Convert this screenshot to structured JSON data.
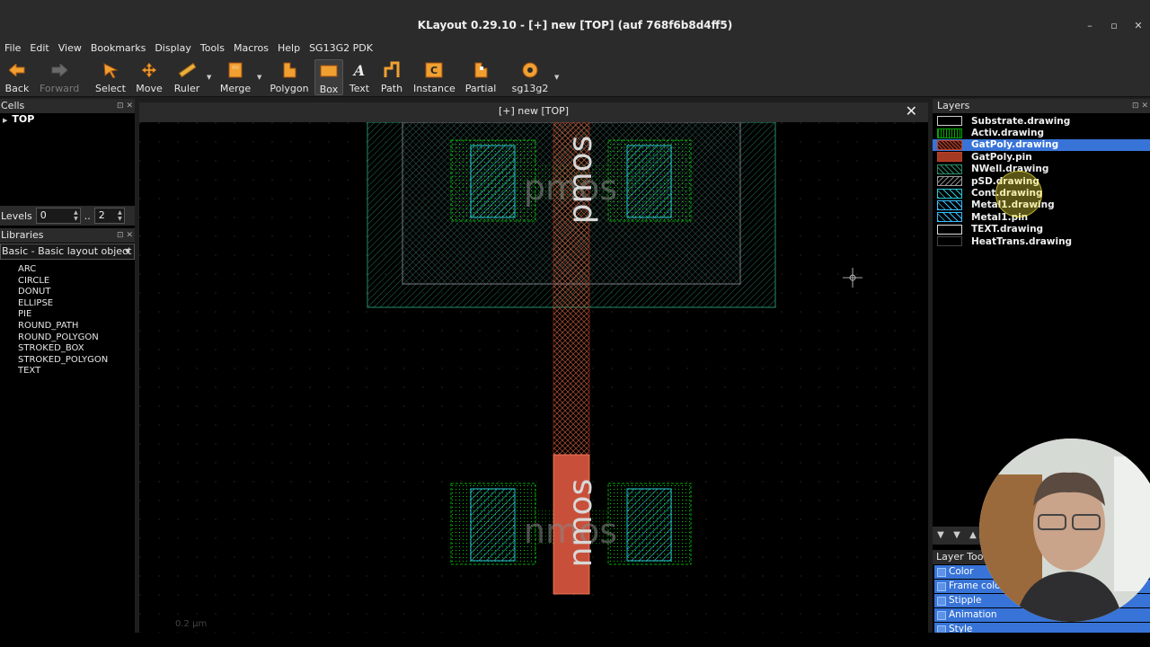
{
  "window": {
    "title": "KLayout 0.29.10 - [+] new [TOP] (auf 768f6b8d4ff5)"
  },
  "menu": [
    "File",
    "Edit",
    "View",
    "Bookmarks",
    "Display",
    "Tools",
    "Macros",
    "Help",
    "SG13G2 PDK"
  ],
  "toolbar": {
    "back": "Back",
    "forward": "Forward",
    "select": "Select",
    "move": "Move",
    "ruler": "Ruler",
    "merge": "Merge",
    "polygon": "Polygon",
    "box": "Box",
    "text": "Text",
    "path": "Path",
    "instance": "Instance",
    "partial": "Partial",
    "sg13g2": "sg13g2"
  },
  "cells": {
    "title": "Cells",
    "top": "TOP"
  },
  "levels": {
    "label": "Levels",
    "from": "0",
    "sep": "..",
    "to": "2"
  },
  "libraries": {
    "title": "Libraries",
    "selected": "Basic - Basic layout object",
    "items": [
      "ARC",
      "CIRCLE",
      "DONUT",
      "ELLIPSE",
      "PIE",
      "ROUND_PATH",
      "ROUND_POLYGON",
      "STROKED_BOX",
      "STROKED_POLYGON",
      "TEXT"
    ]
  },
  "canvas": {
    "tab_title": "[+] new [TOP]",
    "scale_label": "0.2 µm",
    "texts": {
      "pmos": "pmos",
      "nmos": "nmos"
    }
  },
  "layers": {
    "title": "Layers",
    "items": [
      {
        "name": "Substrate.drawing",
        "color": "#ffffff"
      },
      {
        "name": "Activ.drawing",
        "color": "#00ff00"
      },
      {
        "name": "GatPoly.drawing",
        "color": "#bf4026",
        "selected": true
      },
      {
        "name": "GatPoly.pin",
        "color": "#bf4026"
      },
      {
        "name": "NWell.drawing",
        "color": "#268c6b"
      },
      {
        "name": "pSD.drawing",
        "color": "#ccccd9"
      },
      {
        "name": "Cont.drawing",
        "color": "#00ffff"
      },
      {
        "name": "Metal1.drawing",
        "color": "#39bfff"
      },
      {
        "name": "Metal1.pin",
        "color": "#39bfff"
      },
      {
        "name": "TEXT.drawing",
        "color": "#ffffff"
      },
      {
        "name": "HeatTrans.drawing",
        "color": "#000000"
      }
    ]
  },
  "layer_toolbox": {
    "title": "Layer Tools",
    "items": [
      "Color",
      "Frame color",
      "Stipple",
      "Animation",
      "Style"
    ]
  }
}
